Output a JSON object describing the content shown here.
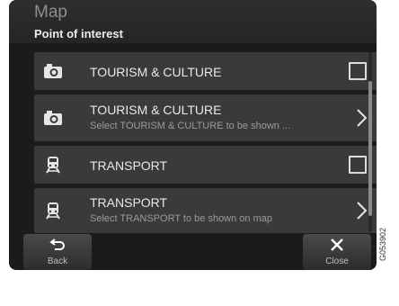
{
  "header": {
    "app_title": "Map",
    "page_title": "Point of interest"
  },
  "list": {
    "items": [
      {
        "label": "TOURISM & CULTURE",
        "sublabel": "",
        "icon": "camera-icon",
        "control": "checkbox",
        "checked": false
      },
      {
        "label": "TOURISM & CULTURE",
        "sublabel": "Select TOURISM & CULTURE to be shown ...",
        "icon": "camera-icon",
        "control": "chevron"
      },
      {
        "label": "TRANSPORT",
        "sublabel": "",
        "icon": "train-icon",
        "control": "checkbox",
        "checked": false
      },
      {
        "label": "TRANSPORT",
        "sublabel": "Select TRANSPORT to be shown on map",
        "icon": "train-icon",
        "control": "chevron"
      }
    ]
  },
  "footer": {
    "back_label": "Back",
    "close_label": "Close"
  },
  "reference_code": "G053902",
  "colors": {
    "background": "#1b1b1b",
    "row": "#3a3a3a",
    "text": "#e8e8e8",
    "subtext": "#9a9a9a"
  }
}
